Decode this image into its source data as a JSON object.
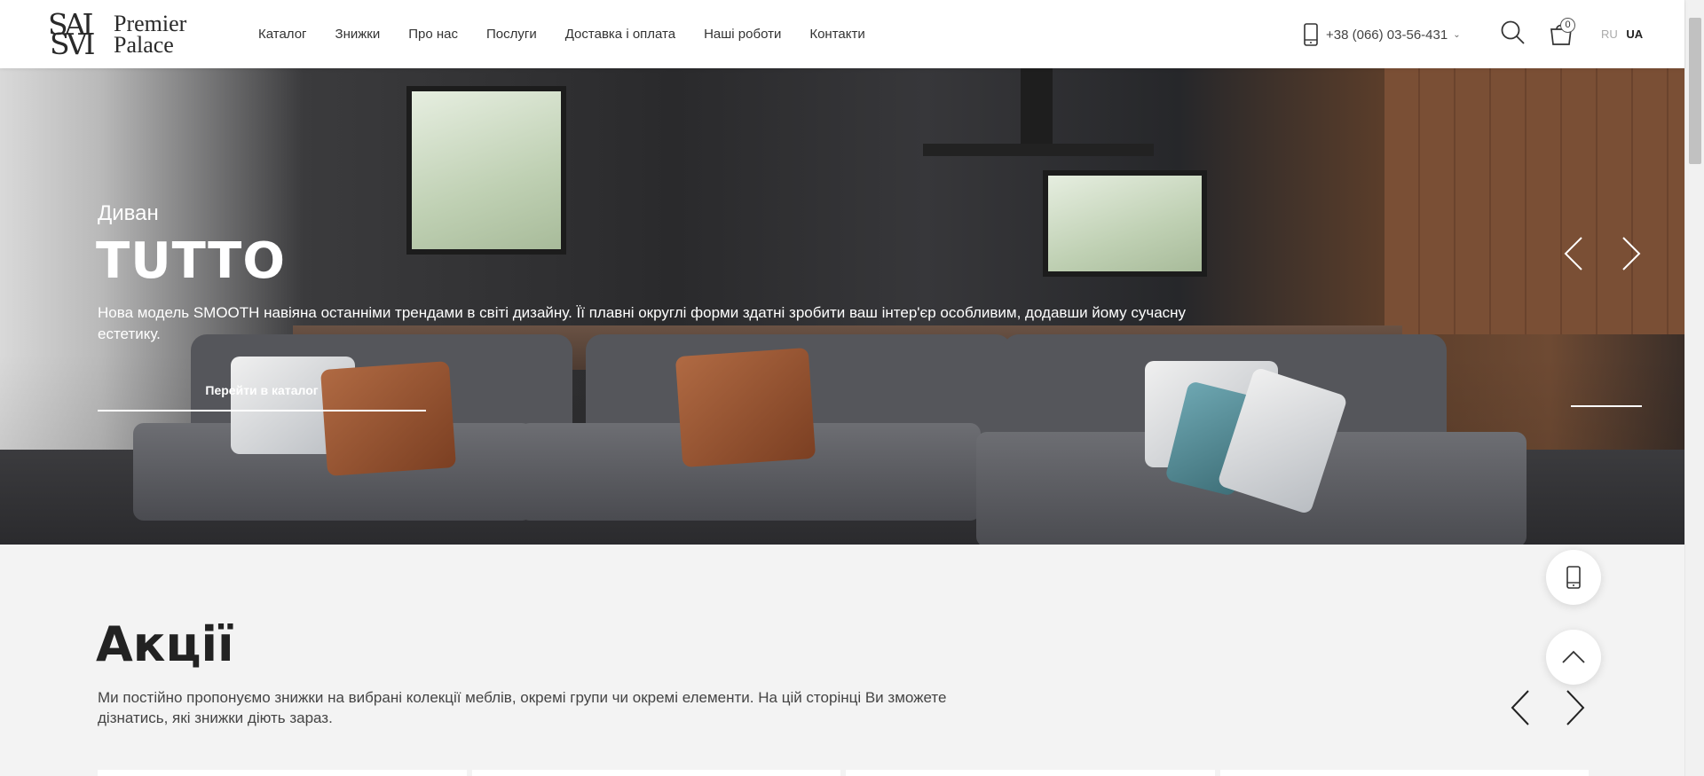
{
  "logo": {
    "monogram_top": "SAI",
    "monogram_bottom": "SVI",
    "line1": "Premier",
    "line2": "Palace"
  },
  "nav": {
    "items": [
      "Каталог",
      "Знижки",
      "Про нас",
      "Послуги",
      "Доставка і оплата",
      "Наші роботи",
      "Контакти"
    ]
  },
  "header": {
    "phone": "+38 (066) 03-56-431",
    "cart_count": "0",
    "lang_ru": "RU",
    "lang_ua": "UA"
  },
  "hero": {
    "subtitle": "Диван",
    "title": "TUTTO",
    "description": "Нова модель SMOOTH навіяна останніми трендами в світі дизайну. Її плавні округлі форми здатні зробити ваш інтер'єр особливим, додавши йому сучасну естетику.",
    "button": "Перейти в каталог"
  },
  "promo": {
    "title": "Акції",
    "description": "Ми постійно пропонуємо знижки на вибрані колекції меблів, окремі групи чи окремі елементи. На цій сторінці Ви зможете дізнатись, які знижки діють зараз."
  },
  "icons": {
    "phone": "phone-icon",
    "search": "search-icon",
    "cart": "cart-icon",
    "prev": "chevron-left-icon",
    "next": "chevron-right-icon",
    "up": "chevron-up-icon"
  }
}
